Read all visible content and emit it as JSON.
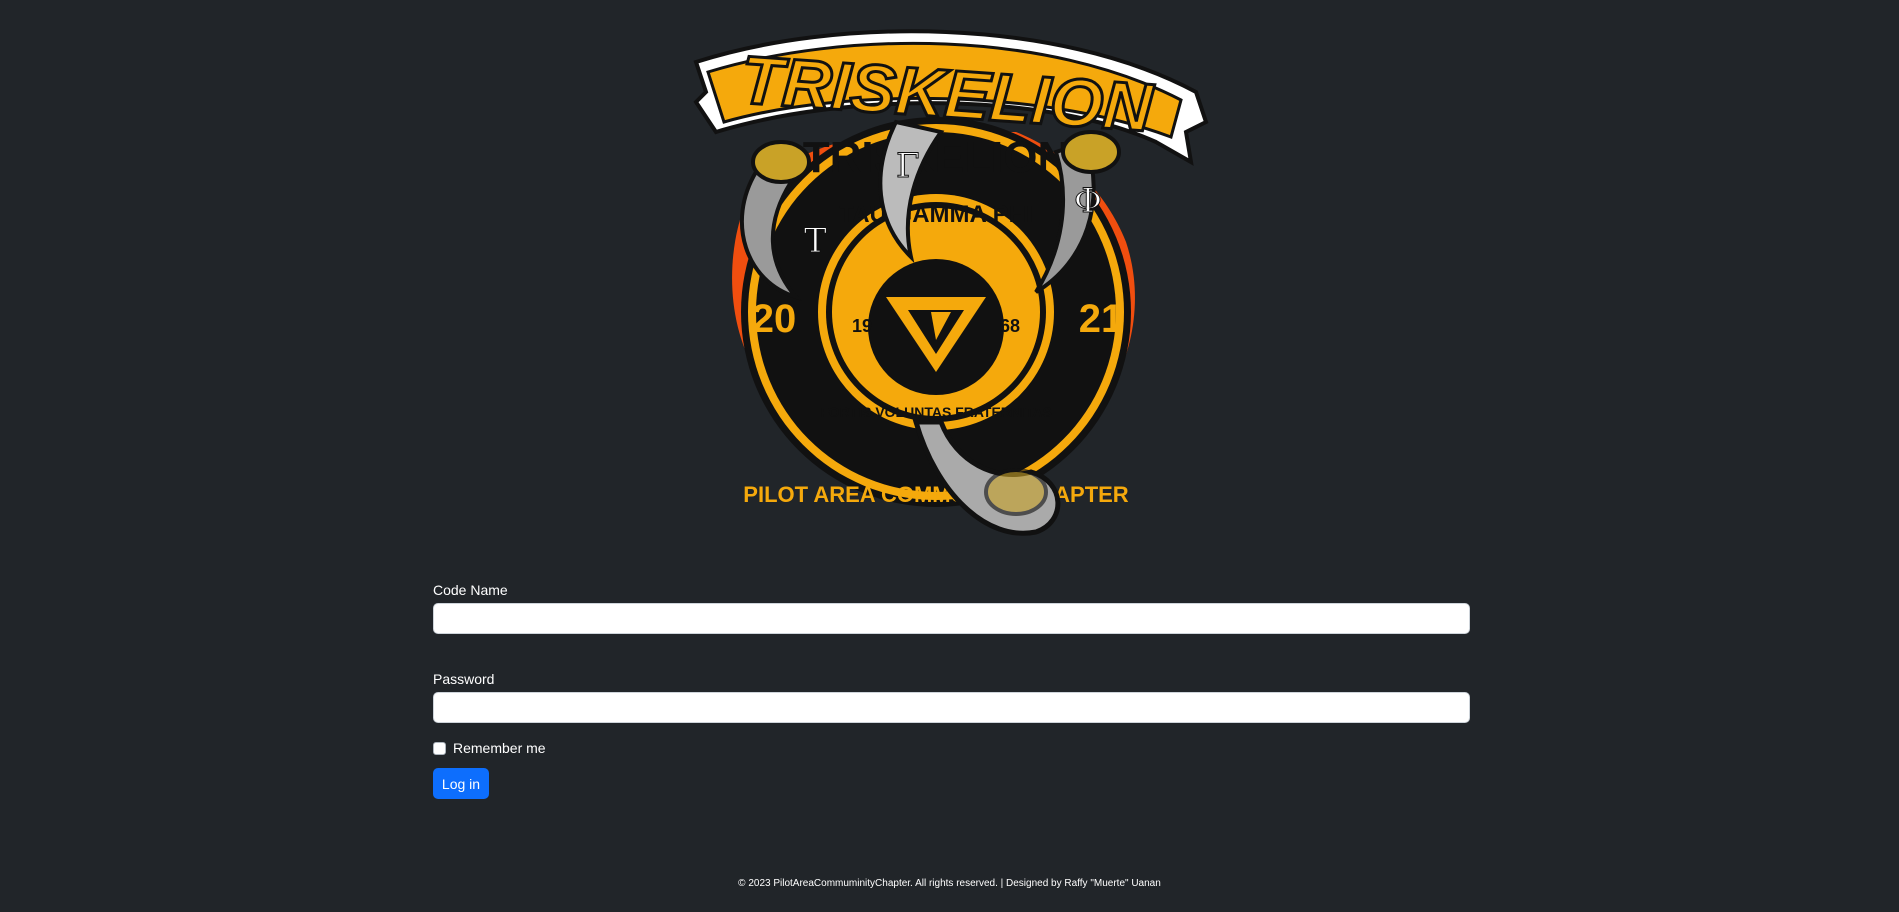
{
  "logo": {
    "banner_text": "TRISKELION",
    "seal_outer_text": "TRISKELION",
    "seal_inner_text": "TAU GAMMA PHI",
    "seal_motto": "FORTIS VOLUNTAS FRATERNITAS",
    "seal_bottom_text": "PILOT AREA COMMUNITY CHAPTER",
    "year_left": "20",
    "year_right": "21",
    "founded_left": "19",
    "founded_right": "68",
    "greek_letters": [
      "T",
      "Γ",
      "Φ"
    ],
    "colors": {
      "gold": "#f5a90c",
      "black": "#111111",
      "flame": "#f04e0f",
      "talon": "#9a9a9a"
    }
  },
  "form": {
    "code_name_label": "Code Name",
    "code_name_value": "",
    "password_label": "Password",
    "password_value": "",
    "remember_label": "Remember me",
    "remember_checked": false,
    "login_label": "Log in"
  },
  "footer": {
    "text": "© 2023 PilotAreaCommuminityChapter. All rights reserved. | Designed by Raffy \"Muerte\" Uanan"
  },
  "theme": {
    "background": "#212529",
    "primary": "#0d6efd"
  }
}
